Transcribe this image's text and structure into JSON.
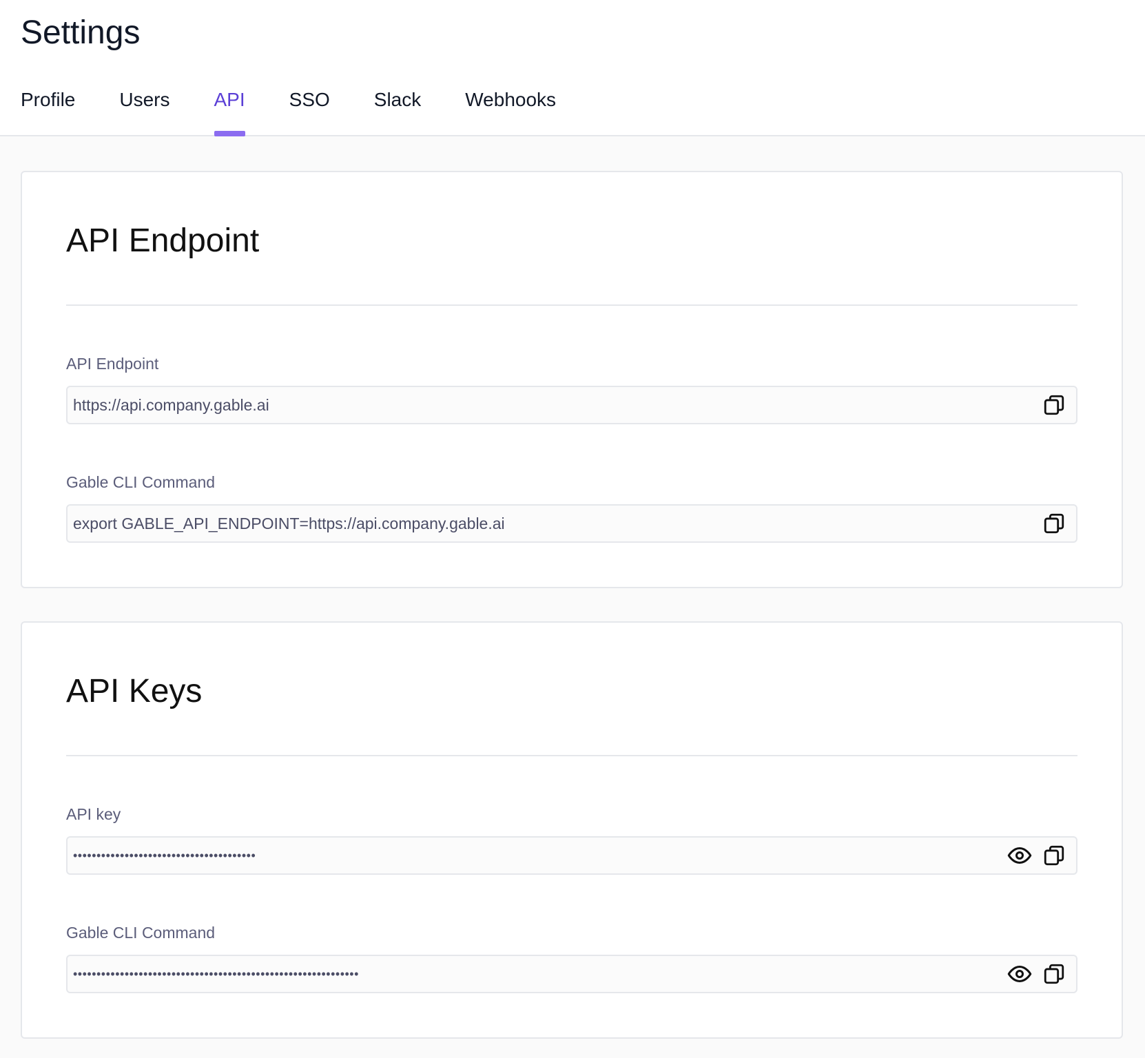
{
  "page": {
    "title": "Settings"
  },
  "tabs": [
    {
      "label": "Profile",
      "active": false
    },
    {
      "label": "Users",
      "active": false
    },
    {
      "label": "API",
      "active": true
    },
    {
      "label": "SSO",
      "active": false
    },
    {
      "label": "Slack",
      "active": false
    },
    {
      "label": "Webhooks",
      "active": false
    }
  ],
  "endpoint_card": {
    "title": "API Endpoint",
    "fields": [
      {
        "label": "API Endpoint",
        "value": "https://api.company.gable.ai",
        "icon": "copy-icon"
      },
      {
        "label": "Gable CLI Command",
        "value": "export GABLE_API_ENDPOINT=https://api.company.gable.ai",
        "icon": "copy-icon"
      }
    ]
  },
  "keys_card": {
    "title": "API Keys",
    "fields": [
      {
        "label": "API key",
        "value": "•••••••••••••••••••••••••••••••••••••••",
        "icons": [
          "eye-icon",
          "copy-icon"
        ]
      },
      {
        "label": "Gable CLI Command",
        "value": "•••••••••••••••••••••••••••••••••••••••••••••••••••••••••••••",
        "icons": [
          "eye-icon",
          "copy-icon"
        ]
      }
    ]
  },
  "colors": {
    "accent": "#8b6cf0",
    "active_tab_text": "#5b3fd6",
    "label": "#5b5d7a",
    "border": "#e5e7eb"
  }
}
